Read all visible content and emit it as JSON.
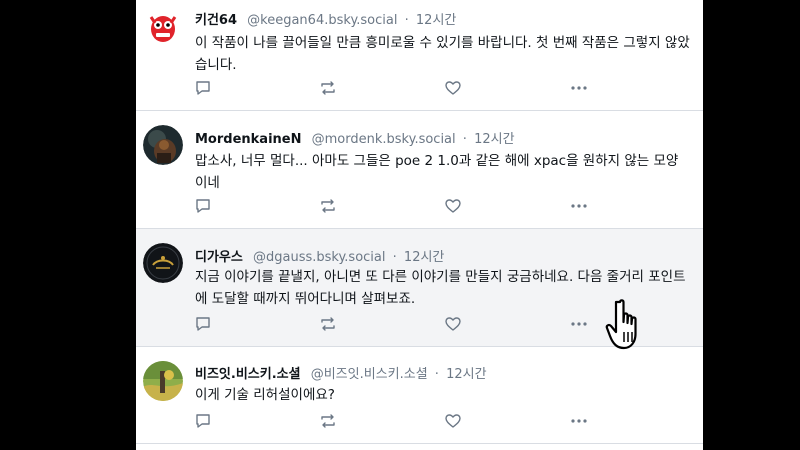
{
  "colors": {
    "text": "#0f1419",
    "muted": "#6b7785",
    "divider": "#d9dde3",
    "highlight_bg": "#f3f4f6"
  },
  "posts": [
    {
      "display_name": "키건64",
      "handle": "@keegan64.bsky.social",
      "separator": "·",
      "time": "12시간",
      "text": "이 작품이 나를 끌어들일 만큼 흥미로울 수 있기를 바랍니다. 첫 번째 작품은 그렇지 않았습니다.",
      "avatar": "red-cartoon-avatar"
    },
    {
      "display_name": "MordenkaineN",
      "handle": "@mordenk.bsky.social",
      "separator": "·",
      "time": "12시간",
      "text": "맙소사, 너무 멀다... 아마도 그들은 poe 2 1.0과 같은 해에 xpac을 원하지 않는 모양이네",
      "avatar": "dark-character-avatar"
    },
    {
      "display_name": "디가우스",
      "handle": "@dgauss.bsky.social",
      "separator": "·",
      "time": "12시간",
      "text": "지금 이야기를 끝낼지, 아니면 또 다른 이야기를 만들지 궁금하네요. 다음 줄거리 포인트에 도달할 때까지 뛰어다니며 살펴보죠.",
      "avatar": "dark-logo-avatar"
    },
    {
      "display_name": "비즈잇.비스키.소셜",
      "handle": "@비즈잇.비스키.소셜",
      "separator": "·",
      "time": "12시간",
      "text": "이게 기술 리허설이에요?",
      "avatar": "green-landscape-avatar"
    }
  ],
  "actions": [
    "reply-icon",
    "repost-icon",
    "like-icon",
    "more-icon"
  ],
  "cursor": "hand-pointer-cursor"
}
